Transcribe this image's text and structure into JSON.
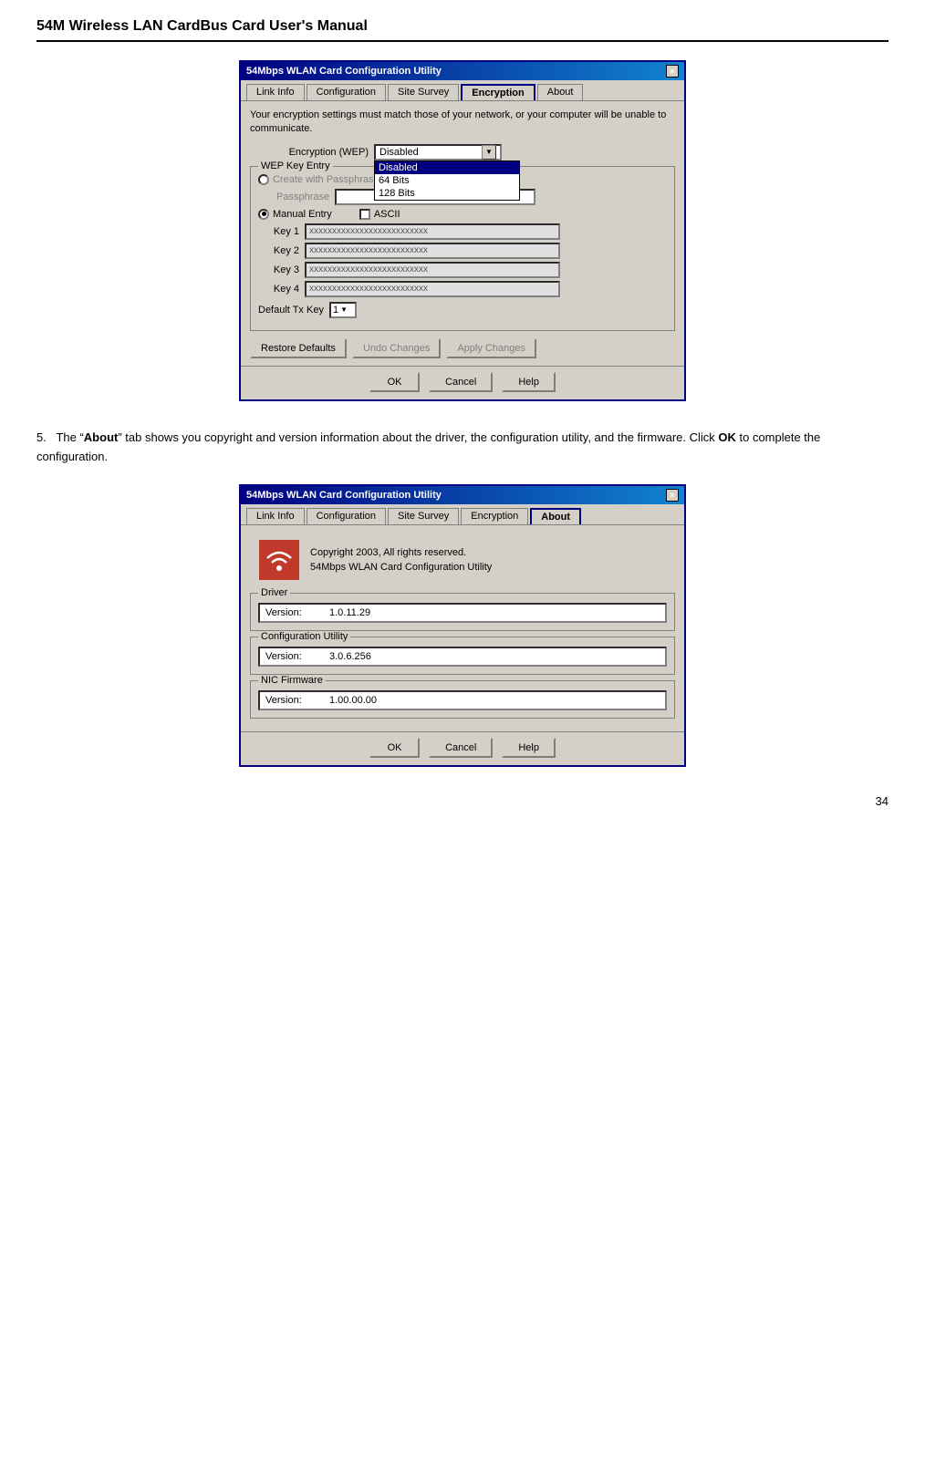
{
  "page": {
    "title": "54M Wireless LAN CardBus Card User's Manual",
    "page_number": "34"
  },
  "dialog1": {
    "titlebar": "54Mbps WLAN Card Configuration Utility",
    "close_button": "×",
    "tabs": [
      {
        "label": "Link Info",
        "active": false
      },
      {
        "label": "Configuration",
        "active": false
      },
      {
        "label": "Site Survey",
        "active": false
      },
      {
        "label": "Encryption",
        "active": true
      },
      {
        "label": "About",
        "active": false
      }
    ],
    "notice": "Your encryption settings must match those of your network, or your computer will be unable to communicate.",
    "encryption_label": "Encryption (WEP)",
    "encryption_value": "Disabled",
    "dropdown_items": [
      {
        "label": "Disabled",
        "selected": true
      },
      {
        "label": "64 Bits",
        "selected": false
      },
      {
        "label": "128 Bits",
        "selected": false
      }
    ],
    "wep_group_title": "WEP Key Entry",
    "create_passphrase_label": "Create with Passphrase",
    "passphrase_label": "Passphrase",
    "manual_entry_label": "Manual Entry",
    "ascii_label": "ASCII",
    "keys": [
      {
        "label": "Key 1",
        "value": "xxxxxxxxxxxxxxxxxxxxxxxxxx"
      },
      {
        "label": "Key 2",
        "value": "xxxxxxxxxxxxxxxxxxxxxxxxxx"
      },
      {
        "label": "Key 3",
        "value": "xxxxxxxxxxxxxxxxxxxxxxxxxx"
      },
      {
        "label": "Key 4",
        "value": "xxxxxxxxxxxxxxxxxxxxxxxxxx"
      }
    ],
    "default_tx_label": "Default Tx Key",
    "default_tx_value": "1",
    "buttons": {
      "restore_defaults": "Restore Defaults",
      "undo_changes": "Undo Changes",
      "apply_changes": "Apply Changes"
    },
    "footer_buttons": {
      "ok": "OK",
      "cancel": "Cancel",
      "help": "Help"
    }
  },
  "section5": {
    "number": "5.",
    "text_before_bold": "The “",
    "bold_text": "About",
    "text_after_bold": "” tab shows you copyright and version information about the driver, the configuration utility, and the firmware. Click ",
    "bold_ok": "OK",
    "text_end": " to complete the configuration."
  },
  "dialog2": {
    "titlebar": "54Mbps WLAN Card Configuration Utility",
    "close_button": "×",
    "tabs": [
      {
        "label": "Link Info",
        "active": false
      },
      {
        "label": "Configuration",
        "active": false
      },
      {
        "label": "Site Survey",
        "active": false
      },
      {
        "label": "Encryption",
        "active": false
      },
      {
        "label": "About",
        "active": true
      }
    ],
    "copyright_line1": "Copyright 2003, All rights reserved.",
    "copyright_line2": "54Mbps WLAN Card Configuration Utility",
    "driver_group": {
      "title": "Driver",
      "version_label": "Version:",
      "version_value": "1.0.11.29"
    },
    "config_group": {
      "title": "Configuration Utility",
      "version_label": "Version:",
      "version_value": "3.0.6.256"
    },
    "nic_group": {
      "title": "NIC Firmware",
      "version_label": "Version:",
      "version_value": "1.00.00.00"
    },
    "footer_buttons": {
      "ok": "OK",
      "cancel": "Cancel",
      "help": "Help"
    }
  }
}
